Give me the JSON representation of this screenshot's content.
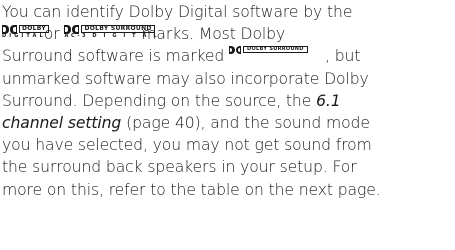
{
  "lines": [
    {
      "text": "You can identify Dolby Digital software by the"
    },
    {
      "between": "or",
      "end": "marks. Most Dolby"
    },
    {
      "start": "Surround software is marked",
      "end": ", but"
    },
    {
      "text": "unmarked software may also incorporate Dolby"
    },
    {
      "text": "Surround. Depending on the source, the"
    },
    {
      "italic": "channel setting",
      "rest": "(page 40), and the sound mode"
    },
    {
      "text": "you have selected, you may not get sound from"
    },
    {
      "text": "the surround back speakers in your setup. For"
    },
    {
      "text": "more on this, refer to the table on the next page."
    }
  ],
  "line5_italic": "6.1",
  "logos": {
    "digital": {
      "box": "DOLBY",
      "sub": "DIGITAL"
    },
    "surround": {
      "box": "DOLBY SURROUND",
      "sub": "AC-3 D I G I T A L"
    },
    "surround_small": {
      "box": "DOLBY SURROUND"
    }
  }
}
